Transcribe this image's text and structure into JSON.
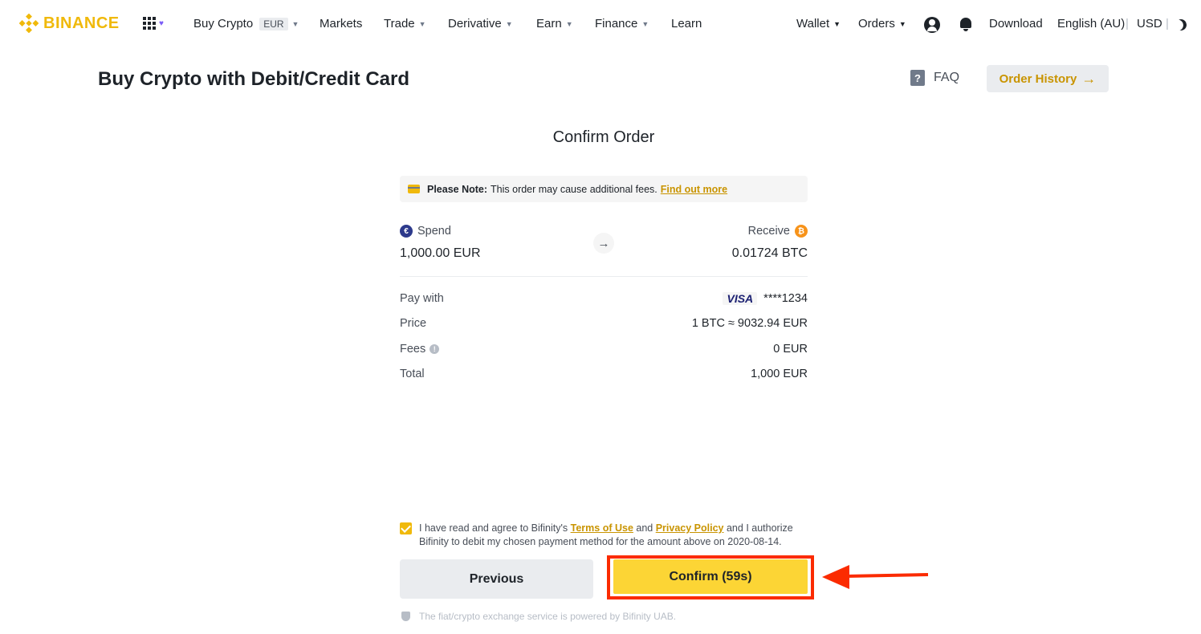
{
  "nav": {
    "logo_text": "BINANCE",
    "buy_crypto": "Buy Crypto",
    "buy_crypto_badge": "EUR",
    "markets": "Markets",
    "trade": "Trade",
    "derivative": "Derivative",
    "earn": "Earn",
    "finance": "Finance",
    "learn": "Learn",
    "wallet": "Wallet",
    "orders": "Orders",
    "download": "Download",
    "language": "English (AU)",
    "currency": "USD"
  },
  "page": {
    "title": "Buy Crypto with Debit/Credit Card",
    "faq": "FAQ",
    "order_history": "Order History"
  },
  "order": {
    "title": "Confirm Order",
    "note_label": "Please Note:",
    "note_text": "This order may cause additional fees.",
    "note_link": "Find out more",
    "spend_label": "Spend",
    "spend_value": "1,000.00 EUR",
    "receive_label": "Receive",
    "receive_value": "0.01724 BTC",
    "rows": [
      {
        "label": "Pay with",
        "value": "****1234",
        "brand": "VISA"
      },
      {
        "label": "Price",
        "value": "1 BTC ≈ 9032.94 EUR"
      },
      {
        "label": "Fees",
        "value": "0 EUR"
      },
      {
        "label": "Total",
        "value": "1,000 EUR"
      }
    ]
  },
  "agreement": {
    "checked": true,
    "text_1": "I have read and agree to Bifinity's",
    "terms_link": "Terms of Use",
    "text_2": "and",
    "privacy_link": "Privacy Policy",
    "text_3": "and I authorize Bifinity to debit my chosen payment method for the amount above on 2020-08-14."
  },
  "buttons": {
    "previous": "Previous",
    "confirm": "Confirm (59s)"
  },
  "footer": {
    "note": "The fiat/crypto exchange service is powered by Bifinity UAB."
  },
  "colors": {
    "brand": "#f0b90b",
    "confirm_button": "#fcd535",
    "highlight_annotation": "#fb2b00",
    "link": "#c99400"
  }
}
